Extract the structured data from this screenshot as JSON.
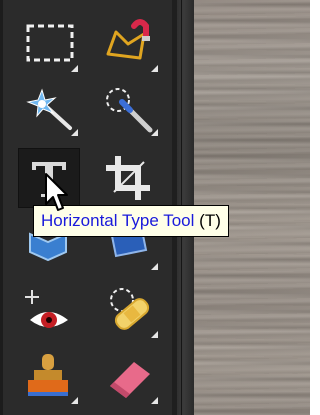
{
  "tools": [
    {
      "id": "marquee",
      "icon": "rectangular-marquee-icon",
      "active": false
    },
    {
      "id": "lasso",
      "icon": "magnetic-lasso-icon",
      "active": false
    },
    {
      "id": "magic-wand",
      "icon": "magic-wand-icon",
      "active": false
    },
    {
      "id": "quick-selection",
      "icon": "quick-selection-brush-icon",
      "active": false
    },
    {
      "id": "type",
      "icon": "type-tool-icon",
      "active": true
    },
    {
      "id": "crop",
      "icon": "crop-tool-icon",
      "active": false
    },
    {
      "id": "cookie-cutter",
      "icon": "cookie-cutter-icon",
      "active": false
    },
    {
      "id": "straighten",
      "icon": "straighten-tool-icon",
      "active": false
    },
    {
      "id": "red-eye",
      "icon": "red-eye-icon",
      "active": false
    },
    {
      "id": "healing",
      "icon": "spot-healing-bandage-icon",
      "active": false
    },
    {
      "id": "clone-stamp",
      "icon": "clone-stamp-icon",
      "active": false
    },
    {
      "id": "eraser",
      "icon": "eraser-icon",
      "active": false
    }
  ],
  "tooltip": {
    "tool_name": "Horizontal Type Tool",
    "shortcut": "(T)",
    "name_color": "#1a1adc",
    "background": "#ffffe8"
  },
  "colors": {
    "toolbox_bg": "#2b2b2b",
    "active_tool_bg": "#1b1b1b"
  }
}
